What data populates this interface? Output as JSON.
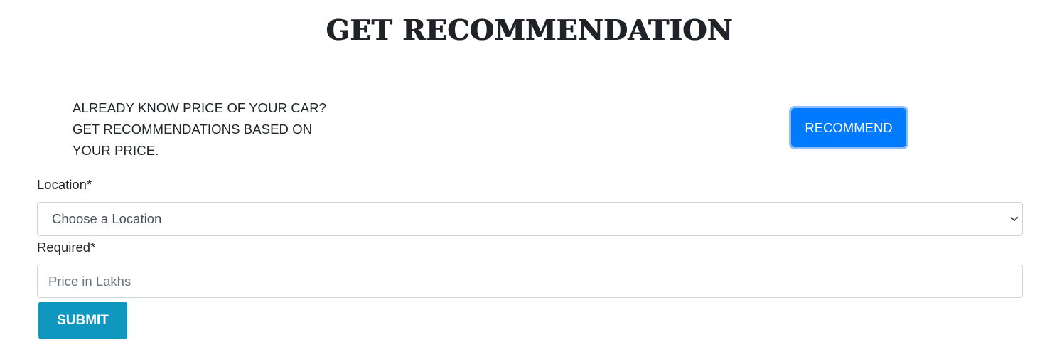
{
  "header": {
    "title": "GET RECOMMENDATION"
  },
  "intro": {
    "lines": [
      "ALREADY KNOW PRICE OF YOUR CAR?",
      "GET RECOMMENDATIONS BASED ON",
      "YOUR PRICE."
    ]
  },
  "recommend_button": {
    "label": "RECOMMEND",
    "color": "#007bff"
  },
  "form": {
    "location_label": "Location*",
    "location_select": {
      "selected": "Choose a Location",
      "icon": "chevron-down-icon"
    },
    "required_label": "Required*",
    "price_input": {
      "value": "",
      "placeholder": "Price in Lakhs"
    },
    "submit_label": "SUBMIT",
    "submit_color": "#0f97c0"
  }
}
